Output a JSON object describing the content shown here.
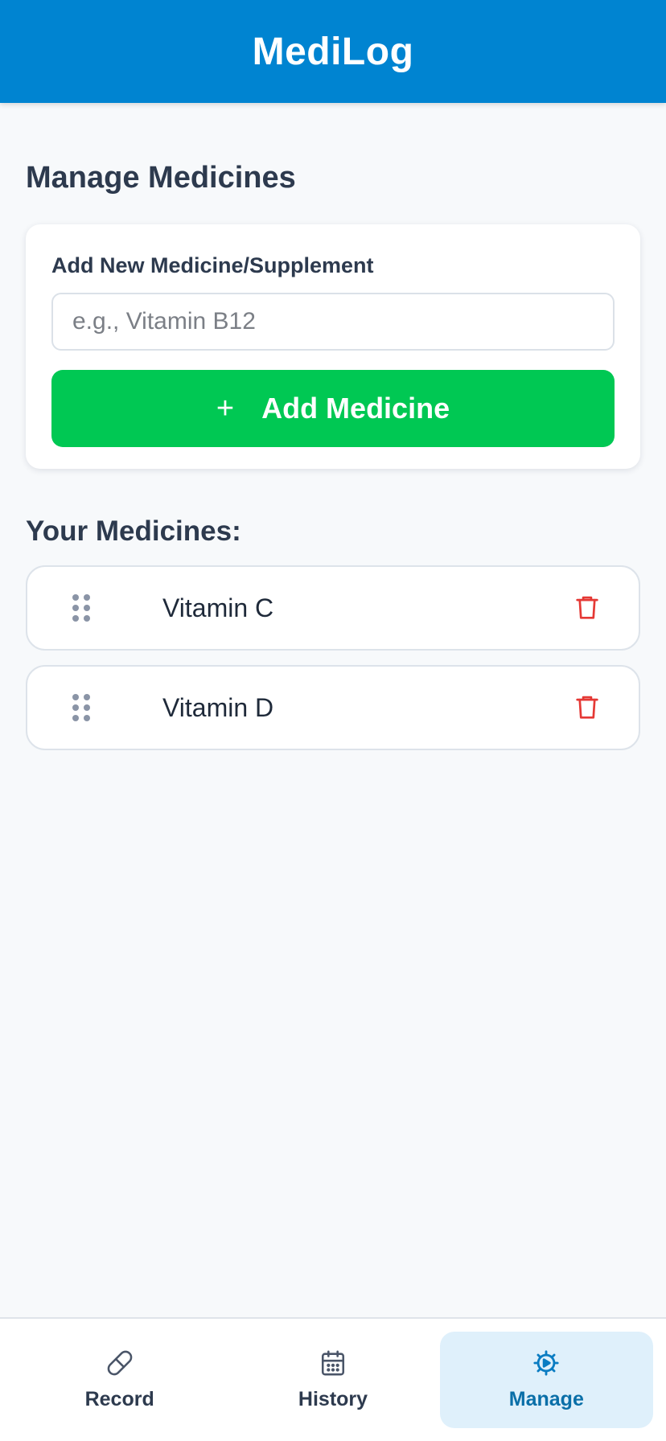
{
  "app": {
    "title": "MediLog"
  },
  "page": {
    "title": "Manage Medicines"
  },
  "add_form": {
    "label": "Add New Medicine/Supplement",
    "input_value": "",
    "input_placeholder": "e.g., Vitamin B12",
    "button_icon": "+",
    "button_label": "Add Medicine"
  },
  "medicines": {
    "heading": "Your Medicines:",
    "items": [
      {
        "name": "Vitamin C",
        "drag_icon": "drag-handle-icon",
        "delete_icon": "trash-icon"
      },
      {
        "name": "Vitamin D",
        "drag_icon": "drag-handle-icon",
        "delete_icon": "trash-icon"
      }
    ]
  },
  "nav": {
    "items": [
      {
        "label": "Record",
        "icon": "pill-icon",
        "active": false
      },
      {
        "label": "History",
        "icon": "calendar-icon",
        "active": false
      },
      {
        "label": "Manage",
        "icon": "gear-icon",
        "active": true
      }
    ]
  },
  "colors": {
    "header": "#0084d1",
    "add_button": "#00c853",
    "delete": "#e53935",
    "nav_active_bg": "#dff0fb",
    "nav_active_text": "#0a6fa8"
  }
}
